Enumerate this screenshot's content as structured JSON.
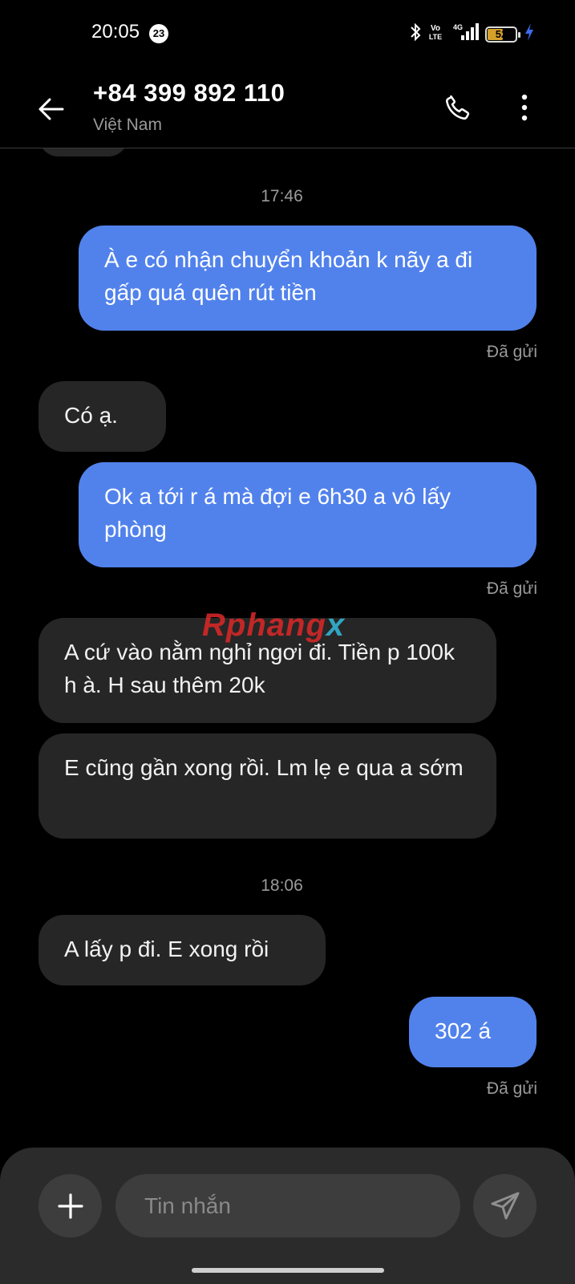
{
  "status_bar": {
    "time": "20:05",
    "notification_count": "23",
    "battery_level": "52",
    "icons": [
      "bluetooth-icon",
      "volte-icon",
      "4g-signal-icon",
      "battery-icon",
      "charging-icon"
    ],
    "volte_label": "Vo LTE",
    "network_label": "4G",
    "colors": {
      "battery": "#d6a12a",
      "charging": "#3b6cf2"
    }
  },
  "header": {
    "contact_number": "+84 399 892 110",
    "contact_country": "Việt Nam",
    "icons": [
      "back-arrow-icon",
      "phone-icon",
      "more-vert-icon"
    ]
  },
  "chat": {
    "messages": [
      {
        "type": "timestamp",
        "text": "17:46"
      },
      {
        "type": "outgoing",
        "text": "À e có nhận chuyển khoản k nãy a đi gấp quá quên rút tiền",
        "status": "Đã gửi"
      },
      {
        "type": "incoming",
        "text": "Có ạ."
      },
      {
        "type": "outgoing",
        "text": "Ok a tới r á mà đợi e 6h30 a vô lấy phòng",
        "status": "Đã gửi"
      },
      {
        "type": "incoming",
        "text": "A cứ vào nằm nghỉ ngơi đi. Tiền p 100k h à. H sau thêm 20k"
      },
      {
        "type": "incoming",
        "text": "E cũng gần xong rồi. Lm lẹ e qua a sớm"
      },
      {
        "type": "timestamp",
        "text": "18:06"
      },
      {
        "type": "incoming",
        "text": "A lấy p đi. E xong rồi"
      },
      {
        "type": "outgoing",
        "text": "302 á",
        "status": "Đã gửi"
      }
    ],
    "colors": {
      "outgoing": "#5182ec",
      "incoming": "#262626"
    }
  },
  "watermark": {
    "main": "Rphang",
    "suffix": "x"
  },
  "composer": {
    "placeholder": "Tin nhắn",
    "value": "",
    "icons": [
      "plus-icon",
      "send-icon"
    ]
  }
}
